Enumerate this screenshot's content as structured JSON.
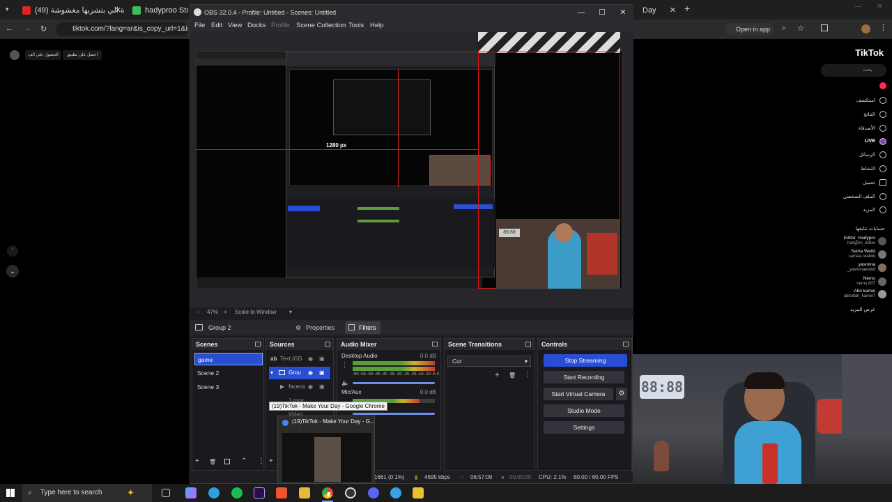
{
  "browser": {
    "tabs": [
      {
        "label": "(49) القهوة الي بتشربها مغشوشة",
        "color": "#e02424"
      },
      {
        "label": "hadyproo Stream",
        "color": "#3fbf5a"
      },
      {
        "label": "Day",
        "color": "#eeeeee"
      }
    ],
    "address": "tiktok.com/?lang=ar&is_copy_url=1&is_f",
    "open_in_app": "Open in app"
  },
  "tiktok": {
    "brand": "TikTok",
    "search_placeholder": "بحث",
    "nav": [
      "استكشف",
      "النتائج",
      "الأصدقاء",
      "LIVE",
      "الرسائل",
      "النشاط",
      "تحميل",
      "الملف الشخصي",
      "المزيد"
    ],
    "following_header": "حسابات تتابعها",
    "following": [
      {
        "name": "Editor_Hadypro",
        "handle": "hadypro_editor"
      },
      {
        "name": "Sama Walid",
        "handle": "samaa..walidd"
      },
      {
        "name": "yasmina",
        "handle": "_yasminaelabd"
      },
      {
        "name": "Nemo",
        "handle": "nemo.807"
      },
      {
        "name": "Abo kamel",
        "handle": "abdullah_kamel7"
      }
    ],
    "show_more": "عرض المزيد",
    "left_buttons": [
      "احصل على تطبيق",
      "الحصول على الف"
    ]
  },
  "obs": {
    "title": "OBS 32.0.4 - Profile: Untitled - Scenes: Untitled",
    "menu": [
      "File",
      "Edit",
      "View",
      "Docks",
      "Profile",
      "Scene Collection",
      "Tools",
      "Help"
    ],
    "preview_label": "1280 px",
    "zoom": "47%",
    "scale_mode": "Scale to Window",
    "selected_source": "Group 2",
    "properties_label": "Properties",
    "filters_label": "Filters",
    "docks": {
      "scenes": {
        "title": "Scenes",
        "items": [
          "game",
          "Scene 2",
          "Scene 3"
        ],
        "selected": 0
      },
      "sources": {
        "title": "Sources",
        "items": [
          "Text (GD",
          "Grou",
          "facecа",
          "1 mov",
          "Video"
        ]
      },
      "audio": {
        "title": "Audio Mixer",
        "channels": [
          {
            "name": "Desktop Audio",
            "db": "0.0 dB"
          },
          {
            "name": "Mic/Aux",
            "db": "0.0 dB"
          }
        ],
        "scale": "-60 -55 -50 -45 -40 -35 -30 -25 -20 -15 -10 -5 0"
      },
      "transitions": {
        "title": "Scene Transitions",
        "value": "Cut"
      },
      "controls": {
        "title": "Controls",
        "buttons": [
          "Stop Streaming",
          "Start Recording",
          "Start Virtual Camera",
          "Studio Mode",
          "Settings"
        ]
      }
    },
    "status": {
      "dropped": "1661 (0.1%)",
      "bitrate": "4695 kbps",
      "stream_time": "06:57:09",
      "rec_time": "00:00:00",
      "cpu": "CPU: 2.1%",
      "fps": "60.00 / 60.00 FPS"
    }
  },
  "tooltip": "(19)TikTok - Make Your Day - Google Chrome",
  "thumbnail_title": "(19)TikTok - Make Your Day - G...",
  "taskbar": {
    "search_placeholder": "Type here to search"
  },
  "webcam": {
    "clock": "88:88"
  }
}
